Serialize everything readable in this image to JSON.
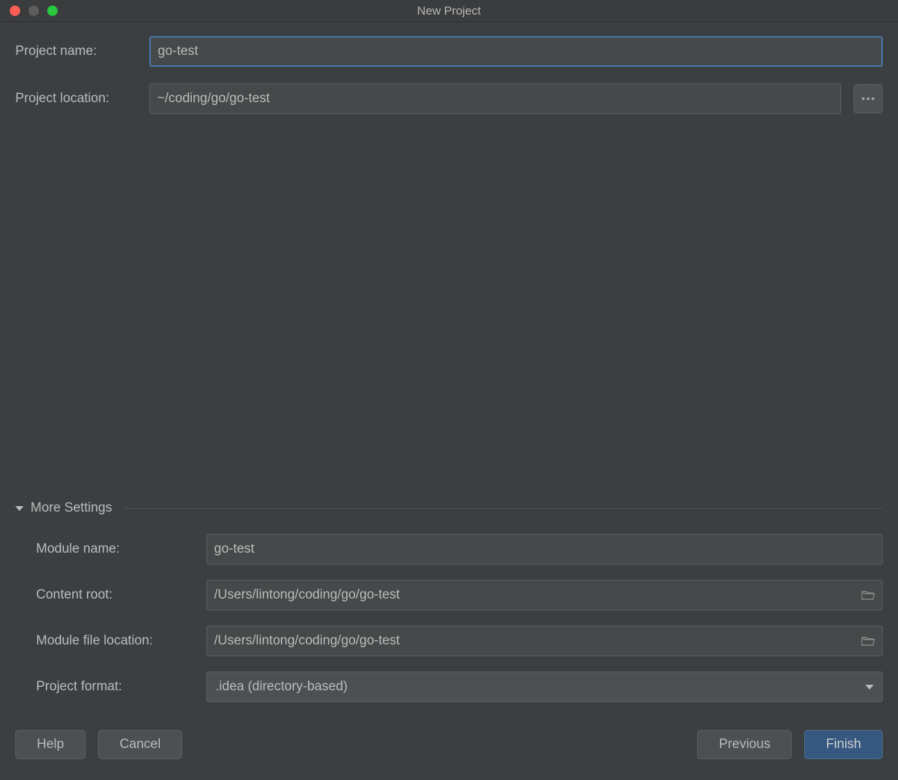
{
  "window": {
    "title": "New Project"
  },
  "form": {
    "project_name": {
      "label": "Project name:",
      "value": "go-test"
    },
    "project_location": {
      "label": "Project location:",
      "value": "~/coding/go/go-test"
    }
  },
  "more_settings": {
    "title": "More Settings",
    "module_name": {
      "label": "Module name:",
      "value": "go-test"
    },
    "content_root": {
      "label": "Content root:",
      "value": "/Users/lintong/coding/go/go-test"
    },
    "module_file_location": {
      "label": "Module file location:",
      "value": "/Users/lintong/coding/go/go-test"
    },
    "project_format": {
      "label": "Project format:",
      "value": ".idea (directory-based)"
    }
  },
  "buttons": {
    "help": "Help",
    "cancel": "Cancel",
    "previous": "Previous",
    "finish": "Finish"
  }
}
